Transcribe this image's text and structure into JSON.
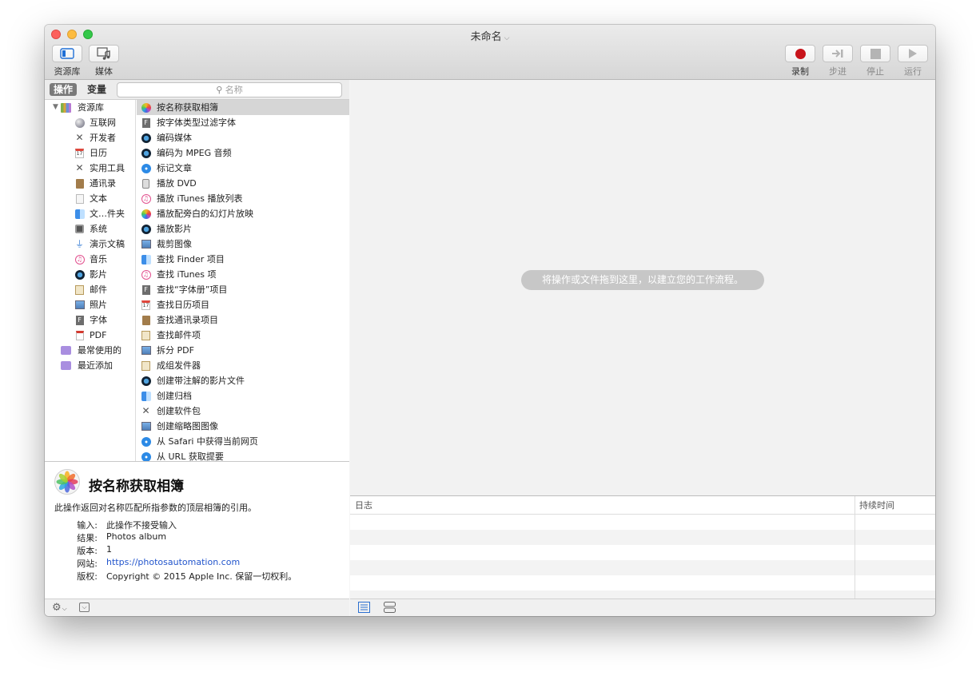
{
  "window": {
    "title": "未命名"
  },
  "toolbar": {
    "library_label": "资源库",
    "media_label": "媒体",
    "record_label": "录制",
    "step_label": "步进",
    "stop_label": "停止",
    "run_label": "运行"
  },
  "search": {
    "tab_actions": "操作",
    "tab_variables": "变量",
    "placeholder": "名称"
  },
  "categories": [
    {
      "label": "资源库",
      "icon": "library-icon"
    },
    {
      "label": "互联网",
      "icon": "globe-icon"
    },
    {
      "label": "开发者",
      "icon": "tools-icon"
    },
    {
      "label": "日历",
      "icon": "calendar-icon"
    },
    {
      "label": "实用工具",
      "icon": "tools-icon"
    },
    {
      "label": "通讯录",
      "icon": "contacts-icon"
    },
    {
      "label": "文本",
      "icon": "text-icon"
    },
    {
      "label": "文…件夹",
      "icon": "finder-icon"
    },
    {
      "label": "系统",
      "icon": "system-icon"
    },
    {
      "label": "演示文稿",
      "icon": "presentation-icon"
    },
    {
      "label": "音乐",
      "icon": "music-icon"
    },
    {
      "label": "影片",
      "icon": "movie-icon"
    },
    {
      "label": "邮件",
      "icon": "mail-icon"
    },
    {
      "label": "照片",
      "icon": "photo-icon"
    },
    {
      "label": "字体",
      "icon": "font-icon"
    },
    {
      "label": "PDF",
      "icon": "pdf-icon"
    },
    {
      "label": "最常使用的",
      "icon": "smart-folder-icon"
    },
    {
      "label": "最近添加",
      "icon": "smart-folder-icon"
    }
  ],
  "actions": [
    {
      "label": "按名称获取相簿",
      "icon": "photos-icon"
    },
    {
      "label": "按字体类型过滤字体",
      "icon": "font-book-icon"
    },
    {
      "label": "编码媒体",
      "icon": "quicktime-icon"
    },
    {
      "label": "编码为 MPEG 音频",
      "icon": "quicktime-icon"
    },
    {
      "label": "标记文章",
      "icon": "safari-icon"
    },
    {
      "label": "播放 DVD",
      "icon": "dvd-player-icon"
    },
    {
      "label": "播放 iTunes 播放列表",
      "icon": "itunes-icon"
    },
    {
      "label": "播放配旁白的幻灯片放映",
      "icon": "photos-icon"
    },
    {
      "label": "播放影片",
      "icon": "quicktime-icon"
    },
    {
      "label": "裁剪图像",
      "icon": "preview-icon"
    },
    {
      "label": "查找 Finder 项目",
      "icon": "finder-icon"
    },
    {
      "label": "查找 iTunes 项",
      "icon": "itunes-icon"
    },
    {
      "label": "查找“字体册”项目",
      "icon": "font-book-icon"
    },
    {
      "label": "查找日历项目",
      "icon": "calendar-icon"
    },
    {
      "label": "查找通讯录项目",
      "icon": "contacts-icon"
    },
    {
      "label": "查找邮件项",
      "icon": "mail-icon"
    },
    {
      "label": "拆分 PDF",
      "icon": "preview-icon"
    },
    {
      "label": "成组发件器",
      "icon": "mail-icon"
    },
    {
      "label": "创建带注解的影片文件",
      "icon": "quicktime-icon"
    },
    {
      "label": "创建归档",
      "icon": "finder-icon"
    },
    {
      "label": "创建软件包",
      "icon": "tools-icon"
    },
    {
      "label": "创建缩略图图像",
      "icon": "preview-icon"
    },
    {
      "label": "从 Safari 中获得当前网页",
      "icon": "safari-icon"
    },
    {
      "label": "从 URL 获取提要",
      "icon": "safari-icon"
    }
  ],
  "description": {
    "title": "按名称获取相簿",
    "summary": "此操作返回对名称匹配所指参数的顶层相簿的引用。",
    "input_key": "输入:",
    "input_value": "此操作不接受输入",
    "result_key": "结果:",
    "result_value": "Photos album",
    "version_key": "版本:",
    "version_value": "1",
    "website_key": "网站:",
    "website_value": "https://photosautomation.com",
    "copyright_key": "版权:",
    "copyright_value": "Copyright © 2015 Apple Inc. 保留一切权利。"
  },
  "workflow": {
    "hint": "将操作或文件拖到这里，以建立您的工作流程。"
  },
  "log": {
    "col_log": "日志",
    "col_duration": "持续时间"
  },
  "colors": {
    "record": "#c8141b",
    "selection": "#d6d6d6",
    "link": "#2255cc"
  }
}
